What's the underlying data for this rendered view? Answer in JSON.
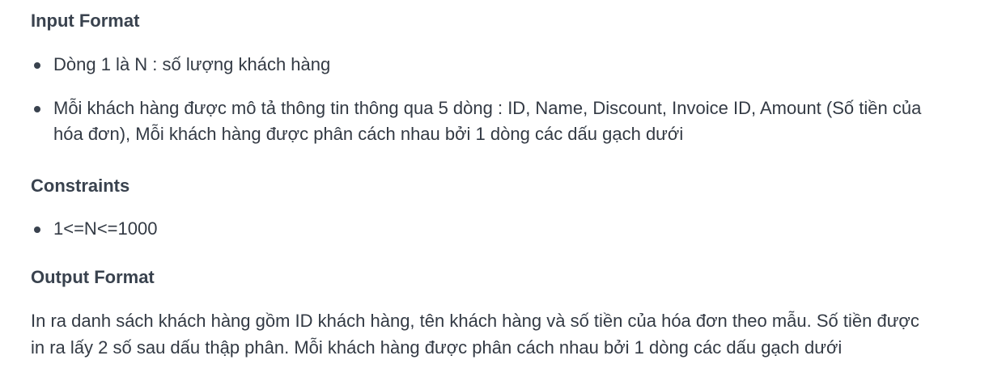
{
  "input_format": {
    "heading": "Input Format",
    "items": [
      "Dòng 1 là N : số lượng khách hàng",
      "Mỗi khách hàng được mô tả thông tin thông qua 5 dòng : ID, Name, Discount, Invoice ID, Amount (Số tiền của hóa đơn), Mỗi khách hàng được phân cách nhau bởi 1 dòng các dấu gạch dưới"
    ]
  },
  "constraints": {
    "heading": "Constraints",
    "items": [
      "1<=N<=1000"
    ]
  },
  "output_format": {
    "heading": "Output Format",
    "text": "In ra danh sách khách hàng gồm ID khách hàng, tên khách hàng và số tiền của hóa đơn theo mẫu. Số tiền được in ra lấy 2 số sau dấu thập phân. Mỗi khách hàng được phân cách nhau bởi 1 dòng các dấu gạch dưới"
  }
}
